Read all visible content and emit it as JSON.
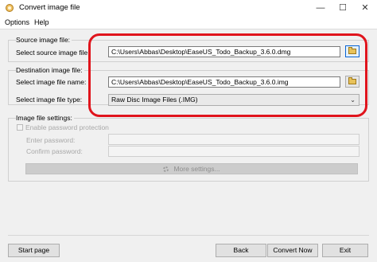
{
  "window": {
    "title": "Convert image file",
    "minimize": "—",
    "maximize": "☐",
    "close": "✕"
  },
  "menu": {
    "items": [
      "Options",
      "Help"
    ]
  },
  "source": {
    "group_label": "Source image file:",
    "field_label": "Select source image file:",
    "path": "C:\\Users\\Abbas\\Desktop\\EaseUS_Todo_Backup_3.6.0.dmg"
  },
  "destination": {
    "group_label": "Destination image file:",
    "name_label": "Select image file name:",
    "path": "C:\\Users\\Abbas\\Desktop\\EaseUS_Todo_Backup_3.6.0.img",
    "type_label": "Select image file type:",
    "type_value": "Raw Disc Image Files (.IMG)"
  },
  "settings": {
    "group_label": "Image file settings:",
    "password_checkbox": "Enable password protection",
    "enter_password": "Enter password:",
    "confirm_password": "Confirm password:",
    "more_settings": "More settings..."
  },
  "buttons": {
    "start_page": "Start page",
    "back": "Back",
    "convert": "Convert Now",
    "exit": "Exit"
  },
  "colors": {
    "highlight": "#e0141c",
    "active_border": "#0a64d4"
  }
}
